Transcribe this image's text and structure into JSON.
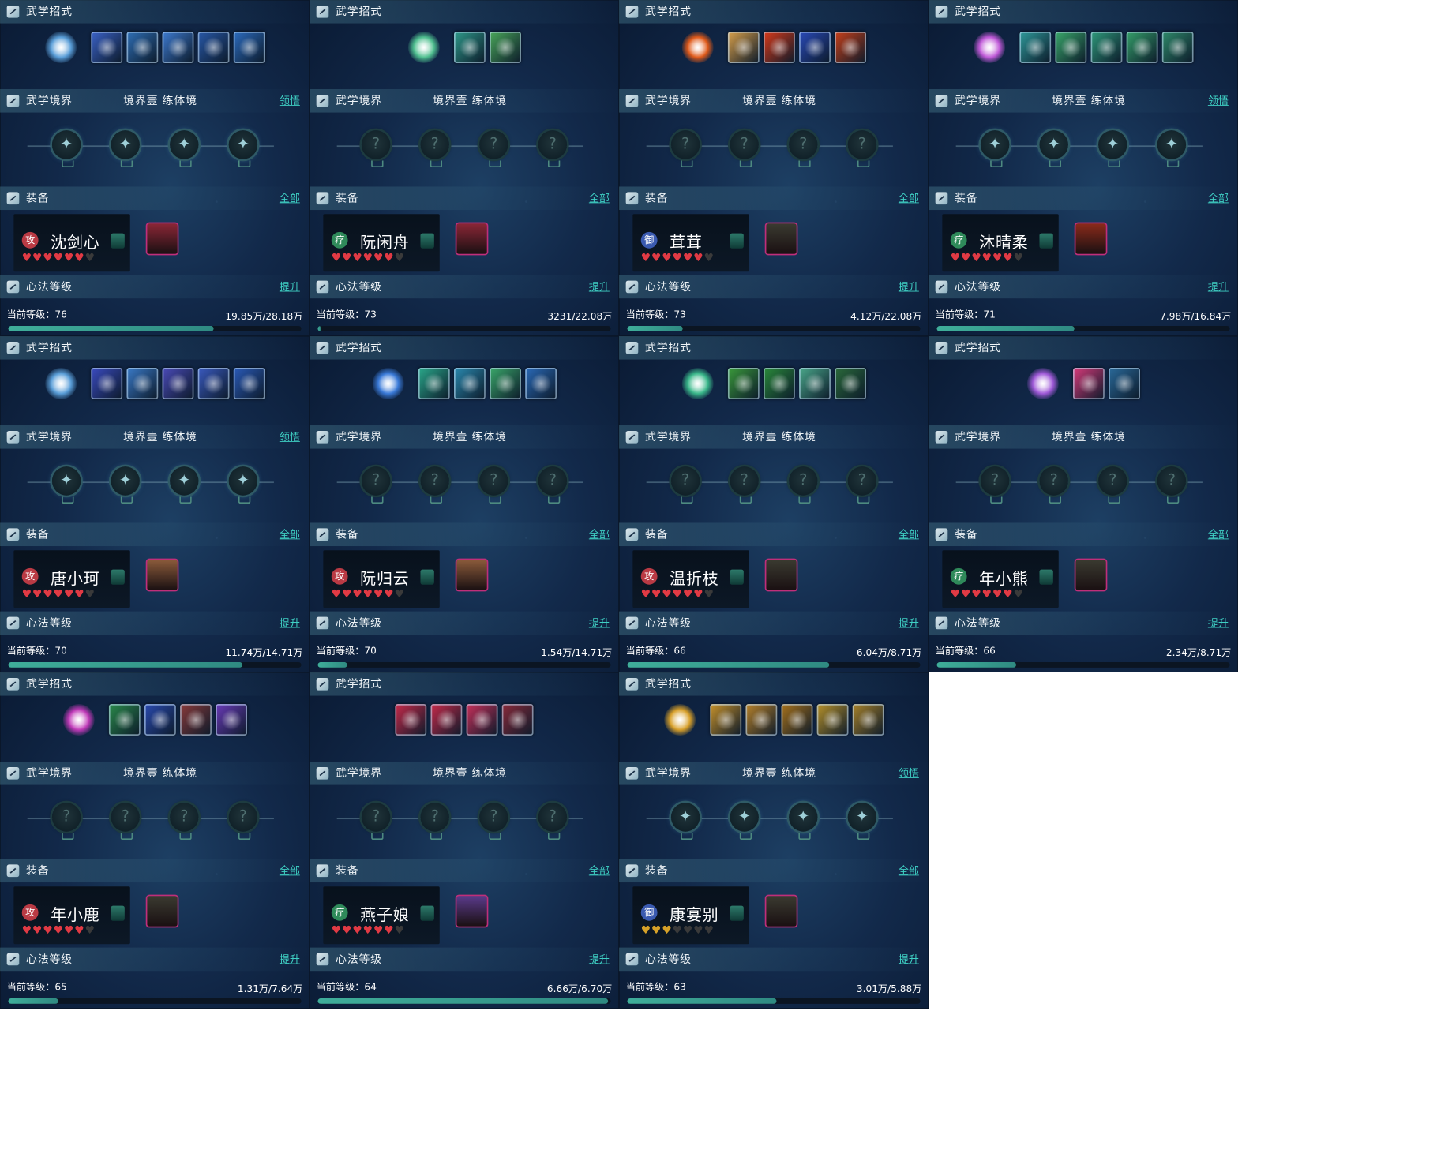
{
  "panels": [
    {
      "skill_title": "武学招式",
      "realm_title": "武学境界",
      "realm_level": "境界壹  练体境",
      "realm_action": "领悟",
      "realm_nodes_lit": true,
      "equip_title": "装备",
      "equip_action": "全部",
      "heart_title": "心法等级",
      "heart_action": "提升",
      "character": {
        "name": "沈剑心",
        "type_tag": "攻",
        "tag_color": "#b93a44",
        "hearts_filled": 6,
        "hearts_total": 7,
        "heart_color": "red"
      },
      "skills": {
        "lead_color": "#5a9ed8",
        "colors": [
          "#3b62c8",
          "#2f6fb6",
          "#3d7ad0",
          "#2858a8",
          "#2c6cc0"
        ]
      },
      "equip_color": "#8a2636",
      "level_label": "当前等级：76",
      "level_progress": "19.85万/28.18万",
      "progress_fraction": 0.7
    },
    {
      "skill_title": "武学招式",
      "realm_title": "武学境界",
      "realm_level": "境界壹  练体境",
      "realm_action": "",
      "realm_nodes_lit": false,
      "equip_title": "装备",
      "equip_action": "全部",
      "heart_title": "心法等级",
      "heart_action": "提升",
      "character": {
        "name": "阮闲舟",
        "type_tag": "疗",
        "tag_color": "#2f8a5a",
        "hearts_filled": 6,
        "hearts_total": 7,
        "heart_color": "red"
      },
      "skills": {
        "lead_color": "#4fbf8f",
        "colors": [
          "#2f9a8a",
          "#4aa85a"
        ]
      },
      "equip_color": "#8a2636",
      "level_label": "当前等级：73",
      "level_progress": "3231/22.08万",
      "progress_fraction": 0.01
    },
    {
      "skill_title": "武学招式",
      "realm_title": "武学境界",
      "realm_level": "境界壹  练体境",
      "realm_action": "",
      "realm_nodes_lit": false,
      "equip_title": "装备",
      "equip_action": "全部",
      "heart_title": "心法等级",
      "heart_action": "提升",
      "character": {
        "name": "茸茸",
        "type_tag": "御",
        "tag_color": "#3a5ab0",
        "hearts_filled": 6,
        "hearts_total": 7,
        "heart_color": "red"
      },
      "skills": {
        "lead_color": "#e05a1a",
        "colors": [
          "#d9a04a",
          "#d93a1a",
          "#2a4ab8",
          "#c8401a"
        ]
      },
      "equip_color": "#3a3a30",
      "level_label": "当前等级：73",
      "level_progress": "4.12万/22.08万",
      "progress_fraction": 0.19
    },
    {
      "skill_title": "武学招式",
      "realm_title": "武学境界",
      "realm_level": "境界壹  练体境",
      "realm_action": "领悟",
      "realm_nodes_lit": true,
      "equip_title": "装备",
      "equip_action": "全部",
      "heart_title": "心法等级",
      "heart_action": "提升",
      "character": {
        "name": "沐晴柔",
        "type_tag": "疗",
        "tag_color": "#2f8a5a",
        "hearts_filled": 6,
        "hearts_total": 7,
        "heart_color": "red"
      },
      "skills": {
        "lead_color": "#c05ad8",
        "colors": [
          "#2f9a9a",
          "#3aa86a",
          "#2f9a7a",
          "#35a06a",
          "#2f8a6a"
        ]
      },
      "equip_color": "#8a2a1a",
      "level_label": "当前等级：71",
      "level_progress": "7.98万/16.84万",
      "progress_fraction": 0.47
    },
    {
      "skill_title": "武学招式",
      "realm_title": "武学境界",
      "realm_level": "境界壹  练体境",
      "realm_action": "领悟",
      "realm_nodes_lit": true,
      "equip_title": "装备",
      "equip_action": "全部",
      "heart_title": "心法等级",
      "heart_action": "提升",
      "character": {
        "name": "唐小珂",
        "type_tag": "攻",
        "tag_color": "#b93a44",
        "hearts_filled": 6,
        "hearts_total": 7,
        "heart_color": "red"
      },
      "skills": {
        "lead_color": "#5a9ed8",
        "colors": [
          "#3a4ac0",
          "#3a7ac8",
          "#4a4ab8",
          "#3a5ac0",
          "#2a5ab8"
        ]
      },
      "equip_color": "#8a5a3a",
      "level_label": "当前等级：70",
      "level_progress": "11.74万/14.71万",
      "progress_fraction": 0.8
    },
    {
      "skill_title": "武学招式",
      "realm_title": "武学境界",
      "realm_level": "境界壹  练体境",
      "realm_action": "",
      "realm_nodes_lit": false,
      "equip_title": "装备",
      "equip_action": "全部",
      "heart_title": "心法等级",
      "heart_action": "提升",
      "character": {
        "name": "阮归云",
        "type_tag": "攻",
        "tag_color": "#b93a44",
        "hearts_filled": 6,
        "hearts_total": 7,
        "heart_color": "red"
      },
      "skills": {
        "lead_color": "#3a7ad8",
        "colors": [
          "#2aa88a",
          "#2a8ab0",
          "#3aa86a",
          "#2a6ab8"
        ]
      },
      "equip_color": "#8a5a3a",
      "level_label": "当前等级：70",
      "level_progress": "1.54万/14.71万",
      "progress_fraction": 0.1
    },
    {
      "skill_title": "武学招式",
      "realm_title": "武学境界",
      "realm_level": "境界壹  练体境",
      "realm_action": "",
      "realm_nodes_lit": false,
      "equip_title": "装备",
      "equip_action": "全部",
      "heart_title": "心法等级",
      "heart_action": "提升",
      "character": {
        "name": "温折枝",
        "type_tag": "攻",
        "tag_color": "#b93a44",
        "hearts_filled": 6,
        "hearts_total": 7,
        "heart_color": "red"
      },
      "skills": {
        "lead_color": "#3ab88a",
        "colors": [
          "#3a9a3a",
          "#2a8a3a",
          "#4aa88a",
          "#2a6a3a"
        ]
      },
      "equip_color": "#3a3a30",
      "level_label": "当前等级：66",
      "level_progress": "6.04万/8.71万",
      "progress_fraction": 0.69
    },
    {
      "skill_title": "武学招式",
      "realm_title": "武学境界",
      "realm_level": "境界壹  练体境",
      "realm_action": "",
      "realm_nodes_lit": false,
      "equip_title": "装备",
      "equip_action": "全部",
      "heart_title": "心法等级",
      "heart_action": "提升",
      "character": {
        "name": "年小熊",
        "type_tag": "疗",
        "tag_color": "#2f8a5a",
        "hearts_filled": 6,
        "hearts_total": 7,
        "heart_color": "red"
      },
      "skills": {
        "lead_color": "#a05ad8",
        "colors": [
          "#d83a7a",
          "#2a6a9a"
        ]
      },
      "equip_color": "#3a3a30",
      "level_label": "当前等级：66",
      "level_progress": "2.34万/8.71万",
      "progress_fraction": 0.27
    },
    {
      "skill_title": "武学招式",
      "realm_title": "武学境界",
      "realm_level": "境界壹  练体境",
      "realm_action": "",
      "realm_nodes_lit": false,
      "equip_title": "装备",
      "equip_action": "全部",
      "heart_title": "心法等级",
      "heart_action": "提升",
      "character": {
        "name": "年小鹿",
        "type_tag": "攻",
        "tag_color": "#b93a44",
        "hearts_filled": 6,
        "hearts_total": 7,
        "heart_color": "red"
      },
      "skills": {
        "lead_color": "#c03ab8",
        "colors": [
          "#2a8a4a",
          "#2a4ab0",
          "#8a3a3a",
          "#6a3ab8"
        ]
      },
      "equip_color": "#3a3a30",
      "level_label": "当前等级：65",
      "level_progress": "1.31万/7.64万",
      "progress_fraction": 0.17
    },
    {
      "skill_title": "武学招式",
      "realm_title": "武学境界",
      "realm_level": "境界壹  练体境",
      "realm_action": "",
      "realm_nodes_lit": false,
      "equip_title": "装备",
      "equip_action": "全部",
      "heart_title": "心法等级",
      "heart_action": "提升",
      "character": {
        "name": "燕子娘",
        "type_tag": "疗",
        "tag_color": "#2f8a5a",
        "hearts_filled": 6,
        "hearts_total": 7,
        "heart_color": "red"
      },
      "skills": {
        "lead_color": "",
        "colors": [
          "#c82a4a",
          "#c82a4a",
          "#c8305a",
          "#8a2a3a"
        ]
      },
      "equip_color": "#5a3a8a",
      "level_label": "当前等级：64",
      "level_progress": "6.66万/6.70万",
      "progress_fraction": 0.99
    },
    {
      "skill_title": "武学招式",
      "realm_title": "武学境界",
      "realm_level": "境界壹  练体境",
      "realm_action": "领悟",
      "realm_nodes_lit": true,
      "equip_title": "装备",
      "equip_action": "全部",
      "heart_title": "心法等级",
      "heart_action": "提升",
      "character": {
        "name": "康宴别",
        "type_tag": "御",
        "tag_color": "#3a5ab0",
        "hearts_filled": 2.5,
        "hearts_total": 7,
        "heart_color": "gold"
      },
      "skills": {
        "lead_color": "#d8a02a",
        "colors": [
          "#c8922a",
          "#b8822a",
          "#a8721a",
          "#b8922a",
          "#a8822a"
        ]
      },
      "equip_color": "#3a3a30",
      "level_label": "当前等级：63",
      "level_progress": "3.01万/5.88万",
      "progress_fraction": 0.51
    }
  ]
}
